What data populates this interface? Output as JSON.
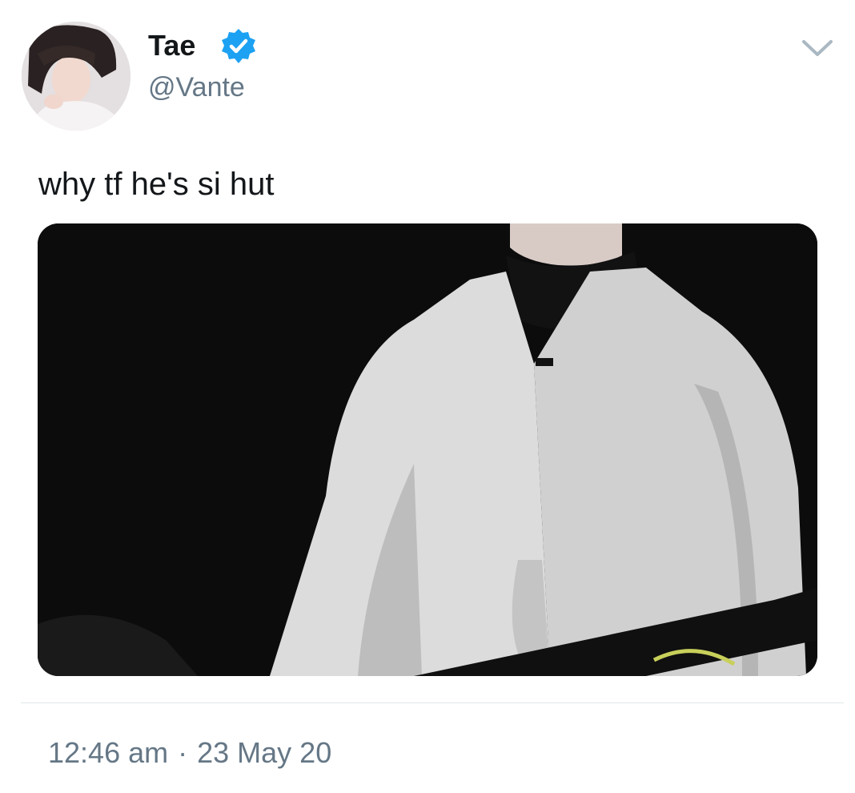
{
  "tweet": {
    "display_name": "Tae",
    "handle": "@Vante",
    "verified_icon": "verified-badge-icon",
    "menu_icon": "chevron-down-icon",
    "text": "why tf he's si hut",
    "time": "12:46 am",
    "separator": "·",
    "date": "23 May 20"
  },
  "colors": {
    "text_primary": "#14171a",
    "text_secondary": "#657786",
    "verified_blue": "#1da1f2",
    "divider": "#e1e8ed"
  }
}
